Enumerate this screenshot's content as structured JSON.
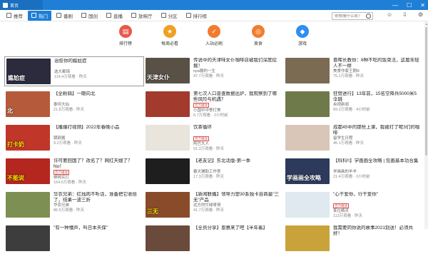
{
  "window": {
    "tab_title": "首页",
    "minimize": "—",
    "maximize": "☐",
    "close": "✕"
  },
  "nav": {
    "items": [
      {
        "label": "推荐",
        "icon": "home-icon"
      },
      {
        "label": "热门",
        "icon": "fire-icon",
        "active": true
      },
      {
        "label": "番剧",
        "icon": "tv-icon"
      },
      {
        "label": "国创",
        "icon": "film-icon"
      },
      {
        "label": "直播",
        "icon": "live-icon"
      },
      {
        "label": "放映厅",
        "icon": "ticket-icon"
      },
      {
        "label": "分区",
        "icon": "grid-icon"
      },
      {
        "label": "排行榜",
        "icon": "chart-icon"
      }
    ],
    "search_placeholder": "你想搜什么呢？"
  },
  "categories": [
    {
      "label": "排行榜",
      "color": "#e8594b",
      "glyph": "▤"
    },
    {
      "label": "每周必看",
      "color": "#f0a023",
      "glyph": "★"
    },
    {
      "label": "入站必刷",
      "color": "#f07d2f",
      "glyph": "✓"
    },
    {
      "label": "美食",
      "color": "#f07d2f",
      "glyph": "◎"
    },
    {
      "label": "游戏",
      "color": "#2f8ef0",
      "glyph": "◆"
    }
  ],
  "videos": [
    {
      "title": "治愈你的尴尬症",
      "badge": "",
      "channel": "选大都锦",
      "meta": "114.4万观看 · 昨天",
      "thumb_bg": "#2b2b3d",
      "thumb_caption": "尴尬症",
      "cap_style": "white",
      "selected": true
    },
    {
      "title": "传说中的天津味女仆咖啡店被我们深度挖掘！",
      "badge": "",
      "channel": "nya酱的一生",
      "meta": "47.7万观看 · 昨天",
      "thumb_bg": "#5a5146",
      "thumb_caption": "天津女仆",
      "cap_style": "white"
    },
    {
      "title": "晋晖长教你：8种不吃的饭菜法，这届年轻人不一样",
      "badge": "",
      "channel": "美食作家王刚R",
      "meta": "75.1万观看 · 昨天",
      "thumb_bg": "#7a6b52",
      "thumb_caption": "",
      "cap_style": "white"
    },
    {
      "title": "【全粉骑】一眼向北",
      "badge": "",
      "channel": "泰坦大仙",
      "meta": "21.8万观看 · 昨天",
      "thumb_bg": "#b55a3a",
      "thumb_caption": "北",
      "cap_style": "white"
    },
    {
      "title": "第七次人口普查数据出炉，我观察到了哪些风险与机遇？",
      "badge": "百万播放",
      "channel": "小国中中季打美",
      "meta": "6.7万观看 · 2小时前",
      "thumb_bg": "#a33a2e",
      "thumb_caption": "",
      "cap_style": "white"
    },
    {
      "title": "狂赞进行】13年前，15名空降兵5000米5伞跳",
      "badge": "",
      "channel": "央视新闻",
      "meta": "69.2万观看 · 4小时前",
      "thumb_bg": "#6f7a4a",
      "thumb_caption": "",
      "cap_style": "white"
    },
    {
      "title": "【播爆打视频】2022年春晚小品",
      "badge": "",
      "channel": "朝颜酱",
      "meta": "9.2万观看 · 昨天",
      "thumb_bg": "#c03628",
      "thumb_caption": "打卡奶",
      "cap_style": "yellow"
    },
    {
      "title": "饮茶循环",
      "badge": "百万播放",
      "channel": "阿巴大人",
      "meta": "91.3万观看 · 昨天",
      "thumb_bg": "#e9e4dc",
      "thumb_caption": "",
      "cap_style": "white"
    },
    {
      "title": "成都45中的那些上课，我被打了呢3们的咖啡",
      "badge": "",
      "channel": "留学生日程",
      "meta": "45.1万观看 · 昨天",
      "thumb_bg": "#d9c6b8",
      "thumb_caption": "",
      "cap_style": "white"
    },
    {
      "title": "许可要回国了？改名了？网红天嫂了？No！",
      "badge": "百万播放",
      "channel": "柳桃实打",
      "meta": "164.6万观看 · 昨天",
      "thumb_bg": "#b3271f",
      "thumb_caption": "不能说",
      "cap_style": "yellow"
    },
    {
      "title": "【老友记】东北话版-第一季",
      "badge": "",
      "channel": "春天辅助工作室",
      "meta": "17.3万观看 · 昨天",
      "thumb_bg": "#1e1e1e",
      "thumb_caption": "",
      "cap_style": "white"
    },
    {
      "title": "【科科!!】学画画全攻略 | 包画基本功合集",
      "badge": "",
      "channel": "学画画的羊羊",
      "meta": "21.4万观看 · 2小时前",
      "thumb_bg": "#2d3a5c",
      "thumb_caption": "学画画全攻略",
      "cap_style": "white"
    },
    {
      "title": "华农兄弟：红烛肉不听话，准备把它收拾了，结果一波三折",
      "badge": "",
      "channel": "华农兄弟",
      "meta": "86.5万观看 · 昨天",
      "thumb_bg": "#7d8f52",
      "thumb_caption": "",
      "cap_style": "white"
    },
    {
      "title": "【新闻联播】领导力塑30系独卡自商最\"三无\"产品",
      "badge": "",
      "channel": "远方的忙碌哥哥",
      "meta": "41.7万观看 · 昨天",
      "thumb_bg": "#8a4b2a",
      "thumb_caption": "三无",
      "cap_style": "yellow"
    },
    {
      "title": "\"心干爱你，行干爱你\"",
      "badge": "百万播放",
      "channel": "某位精灵",
      "meta": "113万观看 · 昨天",
      "thumb_bg": "#dfe9ef",
      "thumb_caption": "",
      "cap_style": "white"
    },
    {
      "title": "\"有一种懵声，叫日本天保\"",
      "badge": "",
      "channel": "",
      "meta": "",
      "thumb_bg": "#3d3d3d",
      "thumb_caption": "",
      "cap_style": "white"
    },
    {
      "title": "【全员分享】恩惠来了吧【半年着】",
      "badge": "",
      "channel": "",
      "meta": "",
      "thumb_bg": "#6a4a3a",
      "thumb_caption": "",
      "cap_style": "white"
    },
    {
      "title": "我需要同你说的故事2021别送！必须共好！",
      "badge": "",
      "channel": "",
      "meta": "",
      "thumb_bg": "#c9a23a",
      "thumb_caption": "",
      "cap_style": "white"
    }
  ]
}
